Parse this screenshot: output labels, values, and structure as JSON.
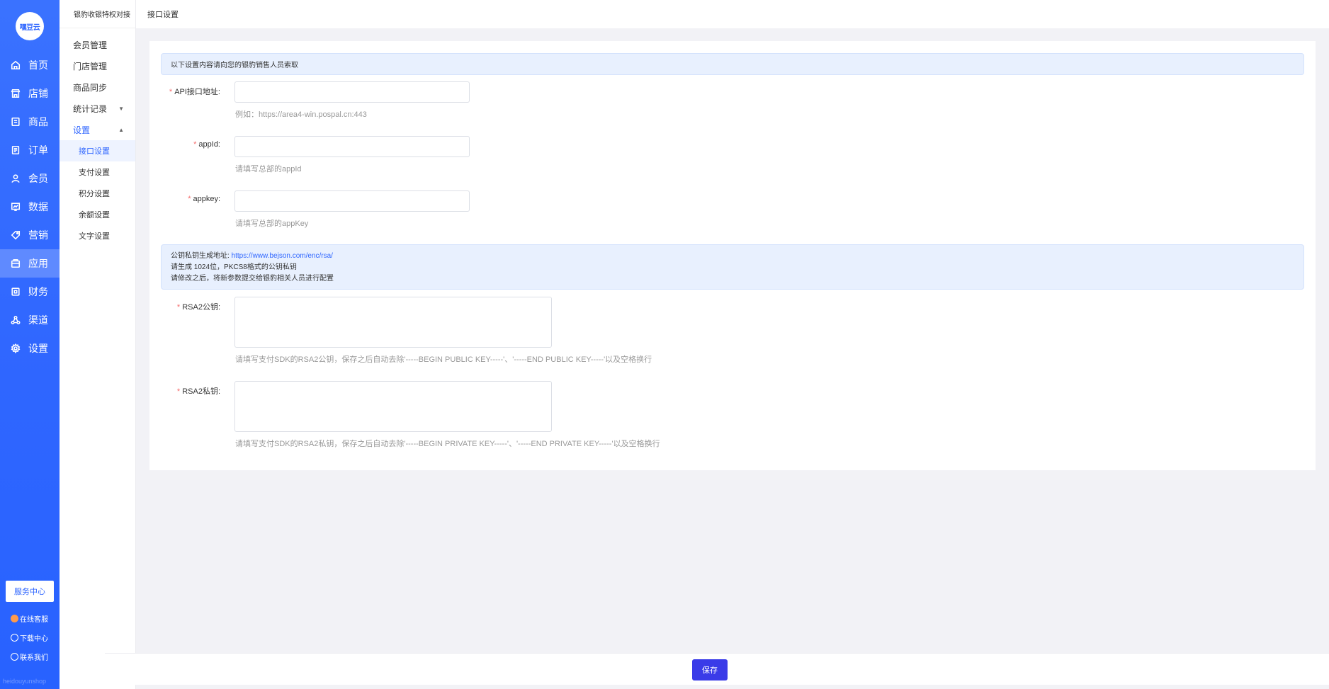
{
  "brand": {
    "logo_text": "嘿豆云"
  },
  "nav": {
    "items": [
      {
        "label": "首页",
        "icon": "home-icon"
      },
      {
        "label": "店铺",
        "icon": "store-icon"
      },
      {
        "label": "商品",
        "icon": "goods-icon"
      },
      {
        "label": "订单",
        "icon": "order-icon"
      },
      {
        "label": "会员",
        "icon": "user-icon"
      },
      {
        "label": "数据",
        "icon": "chart-icon"
      },
      {
        "label": "营销",
        "icon": "tag-icon"
      },
      {
        "label": "应用",
        "icon": "app-icon"
      },
      {
        "label": "财务",
        "icon": "finance-icon"
      },
      {
        "label": "渠道",
        "icon": "channel-icon"
      },
      {
        "label": "设置",
        "icon": "gear-icon"
      }
    ],
    "active": "应用",
    "service_center": "服务中心",
    "online_service": "在线客服",
    "download_center": "下载中心",
    "contact_us": "联系我们",
    "watermark": "heidouyunshop"
  },
  "subnav": {
    "title": "银豹收银特权对接",
    "items": {
      "members": "会员管理",
      "stores": "门店管理",
      "goods_sync": "商品同步",
      "stats": "统计记录",
      "settings": "设置"
    },
    "children": {
      "api": "接口设置",
      "pay": "支付设置",
      "points": "积分设置",
      "balance": "余额设置",
      "text": "文字设置"
    }
  },
  "header": {
    "title": "接口设置"
  },
  "form": {
    "notice1": "以下设置内容请向您的银豹销售人员索取",
    "api_url": {
      "label": "API接口地址:",
      "value": "",
      "hint": "例如：https://area4-win.pospal.cn:443"
    },
    "app_id": {
      "label": "appId:",
      "value": "",
      "hint": "请填写总部的appId"
    },
    "app_key": {
      "label": "appkey:",
      "value": "",
      "hint": "请填写总部的appKey"
    },
    "notice2": {
      "line1_prefix": "公钥私钥生成地址: ",
      "line1_link": "https://www.bejson.com/enc/rsa/",
      "line2": "请生成 1024位，PKCS8格式的公钥私钥",
      "line3": "请修改之后，将新参数提交给银豹相关人员进行配置"
    },
    "rsa_public": {
      "label": "RSA2公钥:",
      "hint": "请填写支付SDK的RSA2公钥，保存之后自动去除'-----BEGIN PUBLIC KEY-----'、'-----END PUBLIC KEY-----'以及空格换行"
    },
    "rsa_private": {
      "label": "RSA2私钥:",
      "hint": "请填写支付SDK的RSA2私钥，保存之后自动去除'-----BEGIN PRIVATE KEY-----'、'-----END PRIVATE KEY-----'以及空格换行"
    }
  },
  "footer": {
    "save_label": "保存"
  },
  "colors": {
    "primary": "#2f66ff",
    "save_button": "#3a3be8",
    "required": "#f56c6c"
  }
}
